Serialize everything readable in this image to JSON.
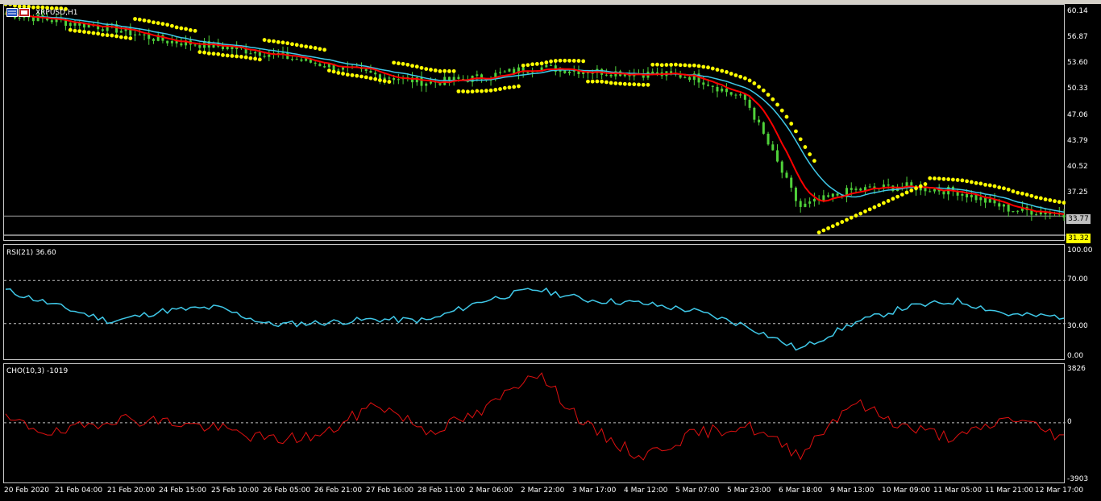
{
  "window": {
    "symbol_title": "XRPUSD,H1"
  },
  "main_pane": {
    "y_ticks": [
      "60.14",
      "56.87",
      "53.60",
      "50.33",
      "47.06",
      "43.79",
      "40.52",
      "37.25"
    ],
    "bid_price": "33.77",
    "low_marker": "31.32"
  },
  "rsi_pane": {
    "label": "RSI(21) 36.60",
    "y_ticks": [
      "100.00",
      "70.00",
      "30.00",
      "0.00"
    ]
  },
  "cho_pane": {
    "label": "CHO(10,3) -1019",
    "y_ticks": [
      "3826",
      "0",
      "-3903"
    ]
  },
  "x_axis": {
    "labels": [
      "20 Feb 2020",
      "21 Feb 04:00",
      "21 Feb 20:00",
      "24 Feb 15:00",
      "25 Feb 10:00",
      "26 Feb 05:00",
      "26 Feb 21:00",
      "27 Feb 16:00",
      "28 Feb 11:00",
      "2 Mar 06:00",
      "2 Mar 22:00",
      "3 Mar 17:00",
      "4 Mar 12:00",
      "5 Mar 07:00",
      "5 Mar 23:00",
      "6 Mar 18:00",
      "9 Mar 13:00",
      "10 Mar 09:00",
      "11 Mar 05:00",
      "11 Mar 21:00",
      "12 Mar 17:00"
    ]
  },
  "colors": {
    "candles": "#4fd13a",
    "sar": "#ffff00",
    "ma_fast": "#ff0000",
    "ma_slow": "#3fc8e8",
    "rsi": "#3fc8e8",
    "cho": "#e01010",
    "price_box": "#c0c0c0",
    "low_box": "#ffff00"
  },
  "chart_data": [
    {
      "type": "line",
      "title": "XRPUSD,H1",
      "x": [
        "20 Feb 2020",
        "21 Feb 04:00",
        "21 Feb 20:00",
        "24 Feb 15:00",
        "25 Feb 10:00",
        "26 Feb 05:00",
        "26 Feb 21:00",
        "27 Feb 16:00",
        "28 Feb 11:00",
        "2 Mar 06:00",
        "2 Mar 22:00",
        "3 Mar 17:00",
        "4 Mar 12:00",
        "5 Mar 07:00",
        "5 Mar 23:00",
        "6 Mar 18:00",
        "9 Mar 13:00",
        "10 Mar 09:00",
        "11 Mar 05:00",
        "11 Mar 21:00",
        "12 Mar 17:00"
      ],
      "series": [
        {
          "values": [
            59.8,
            58.8,
            57.9,
            56.3,
            55.6,
            54.6,
            53.2,
            51.9,
            50.9,
            51.6,
            52.9,
            52.4,
            52.1,
            51.7,
            48.6,
            34.9,
            37.1,
            37.6,
            36.9,
            34.6,
            34.1
          ]
        }
      ],
      "ylim": [
        30.8,
        60.8
      ]
    },
    {
      "type": "line",
      "title": "RSI(21) 36.60",
      "x": [
        "20 Feb 2020",
        "21 Feb 04:00",
        "21 Feb 20:00",
        "24 Feb 15:00",
        "25 Feb 10:00",
        "26 Feb 05:00",
        "26 Feb 21:00",
        "27 Feb 16:00",
        "28 Feb 11:00",
        "2 Mar 06:00",
        "2 Mar 22:00",
        "3 Mar 17:00",
        "4 Mar 12:00",
        "5 Mar 07:00",
        "5 Mar 23:00",
        "6 Mar 18:00",
        "9 Mar 13:00",
        "10 Mar 09:00",
        "11 Mar 05:00",
        "11 Mar 21:00",
        "12 Mar 17:00"
      ],
      "series": [
        {
          "values": [
            61,
            46,
            32,
            42,
            45,
            29,
            31,
            34,
            33,
            51,
            62,
            52,
            49,
            42,
            28,
            6,
            30,
            45,
            51,
            38,
            36.6
          ]
        }
      ],
      "ylim": [
        0,
        100
      ]
    },
    {
      "type": "line",
      "title": "CHO(10,3) -1019",
      "x": [
        "20 Feb 2020",
        "21 Feb 04:00",
        "21 Feb 20:00",
        "24 Feb 15:00",
        "25 Feb 10:00",
        "26 Feb 05:00",
        "26 Feb 21:00",
        "27 Feb 16:00",
        "28 Feb 11:00",
        "2 Mar 06:00",
        "2 Mar 22:00",
        "3 Mar 17:00",
        "4 Mar 12:00",
        "5 Mar 07:00",
        "5 Mar 23:00",
        "6 Mar 18:00",
        "9 Mar 13:00",
        "10 Mar 09:00",
        "11 Mar 05:00",
        "11 Mar 21:00",
        "12 Mar 17:00"
      ],
      "series": [
        {
          "values": [
            200,
            -800,
            300,
            100,
            -400,
            -1200,
            -900,
            1400,
            -600,
            700,
            3700,
            -300,
            -2400,
            -800,
            -200,
            -2200,
            1500,
            -300,
            -1100,
            400,
            -1019
          ]
        }
      ],
      "ylim": [
        -3903,
        3826
      ]
    }
  ]
}
